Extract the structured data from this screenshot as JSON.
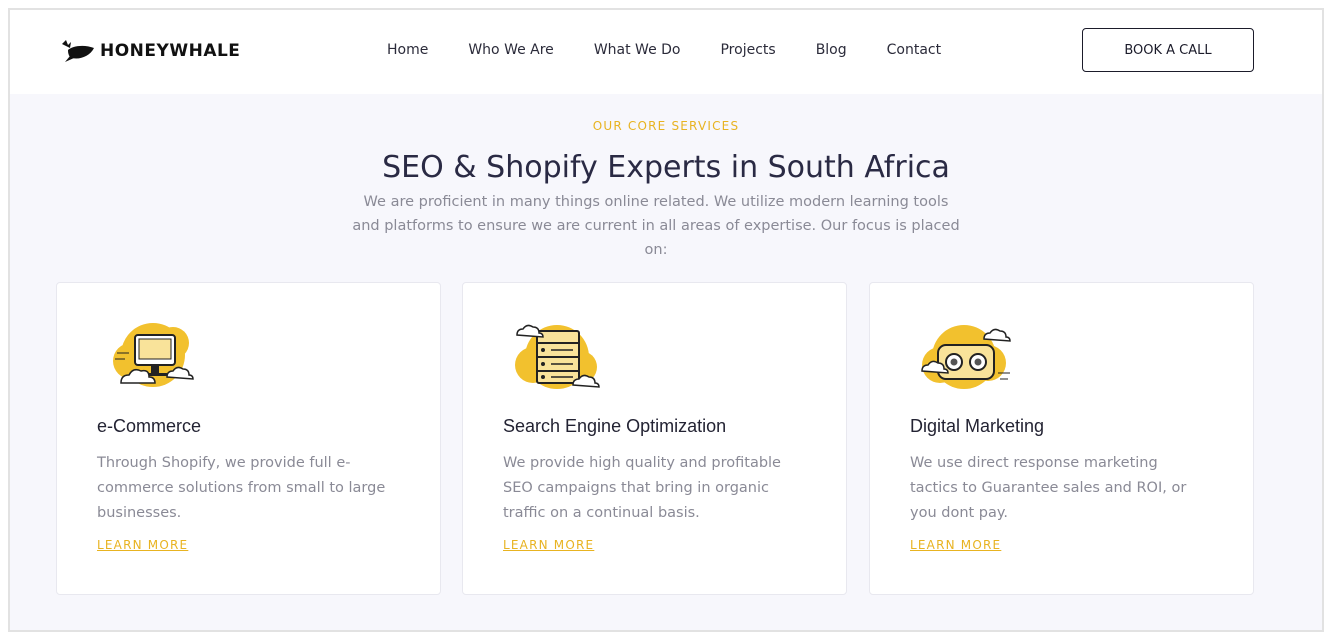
{
  "brand": {
    "name_light": "HONEY",
    "name_bold": "WHALE",
    "accent_color": "#e8b321",
    "icon": "whale-logo-icon"
  },
  "nav": {
    "items": [
      {
        "label": "Home"
      },
      {
        "label": "Who We Are"
      },
      {
        "label": "What We Do"
      },
      {
        "label": "Projects"
      },
      {
        "label": "Blog"
      },
      {
        "label": "Contact"
      }
    ],
    "cta_label": "BOOK A CALL"
  },
  "intro": {
    "eyebrow": "OUR CORE SERVICES",
    "title": "SEO & Shopify Experts in South Africa",
    "subtitle": "We are proficient in many things online related. We utilize modern learning tools and platforms to ensure we are current in all areas of expertise. Our focus is placed on:"
  },
  "services": [
    {
      "title": "e-Commerce",
      "description": "Through Shopify, we provide full e-commerce solutions from small to large businesses.",
      "link_label": "LEARN MORE",
      "icon": "computer-cloud-icon"
    },
    {
      "title": "Search Engine Optimization",
      "description": "We provide high quality and profitable SEO campaigns that bring in organic traffic on a continual basis.",
      "link_label": "LEARN MORE",
      "icon": "server-cloud-icon"
    },
    {
      "title": "Digital Marketing",
      "description": "We use direct response marketing tactics to Guarantee sales and ROI, or you dont pay.",
      "link_label": "LEARN MORE",
      "icon": "vr-headset-icon"
    }
  ]
}
